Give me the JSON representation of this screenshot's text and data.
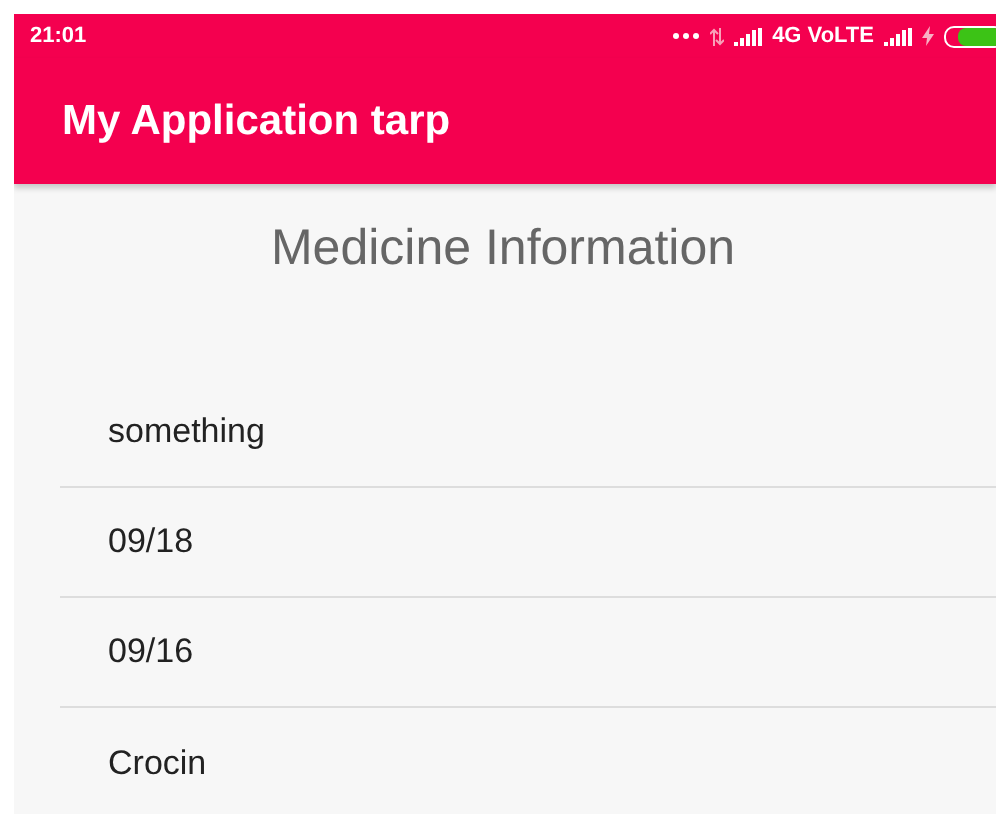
{
  "status_bar": {
    "time": "21:01",
    "network": "4G VoLTE",
    "charging": true
  },
  "app_bar": {
    "title": "My Application tarp"
  },
  "heading": "Medicine Information",
  "list": [
    {
      "text": "something"
    },
    {
      "text": "09/18"
    },
    {
      "text": "09/16"
    },
    {
      "text": "Crocin"
    }
  ]
}
